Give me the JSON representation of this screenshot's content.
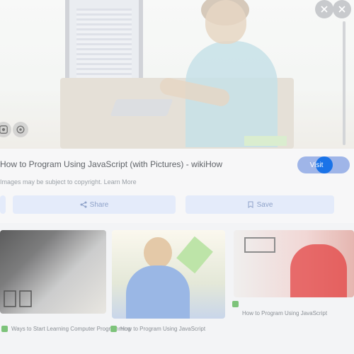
{
  "preview": {
    "title": "How to Program Using JavaScript (with Pictures) - wikiHow",
    "subtitle": "Images may be subject to copyright. Learn More"
  },
  "actions": {
    "visit_label": "Visit",
    "share_label": "Share",
    "save_label": "Save"
  },
  "related": [
    {
      "caption": "Ways to Start Learning Computer Programming"
    },
    {
      "caption": "How to Program Using JavaScript"
    },
    {
      "caption": "How to Program Using JavaScript"
    }
  ],
  "colors": {
    "accent": "#1a73e8",
    "button_light": "#e4ebfa",
    "site_icon": "#7dc37a"
  },
  "icons": [
    "lens-icon",
    "close-icon",
    "more-icon",
    "share-icon",
    "bookmark-icon",
    "copy-icon"
  ]
}
